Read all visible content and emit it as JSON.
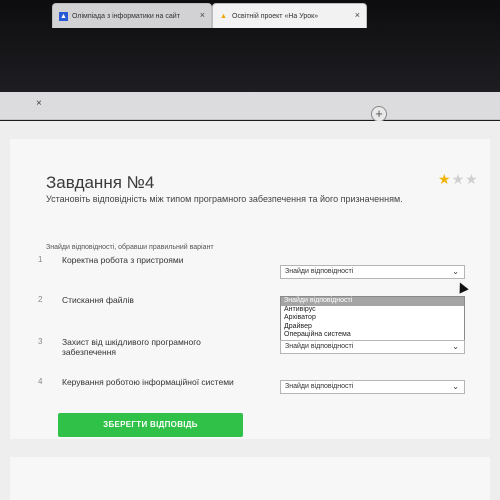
{
  "browser": {
    "tabs": [
      {
        "label": "Олімпіада з інформатики на сайт",
        "close": "×"
      },
      {
        "label": "Освітній проект «На Урок»",
        "close": "×"
      }
    ],
    "lone_close": "×",
    "new_tab": "+"
  },
  "task": {
    "title": "Завдання №4",
    "stars": {
      "filled": 1,
      "total": 3
    },
    "instruction": "Установіть відповідність між типом програмного забезпечення та його призначенням.",
    "hint": "Знайди відповідності, обравши правильний варіант",
    "questions": [
      {
        "number": "1",
        "text": "Коректна робота з пристроями",
        "selected": "Знайди відповідності"
      },
      {
        "number": "2",
        "text": "Стискання файлів",
        "selected": ""
      },
      {
        "number": "3",
        "text": "Захист від шкідливого програмного забезпечення",
        "selected": "Знайди відповідності"
      },
      {
        "number": "4",
        "text": "Керування роботою інформаційної системи",
        "selected": "Знайди відповідності"
      }
    ],
    "dropdown_options": [
      "Знайди відповідності",
      "Антивірус",
      "Архіватор",
      "Драйвер",
      "Операційна система"
    ],
    "save_button": "ЗБЕРЕГТИ ВІДПОВІДЬ"
  },
  "colors": {
    "accent": "#2fc148",
    "star": "#f2b400"
  }
}
